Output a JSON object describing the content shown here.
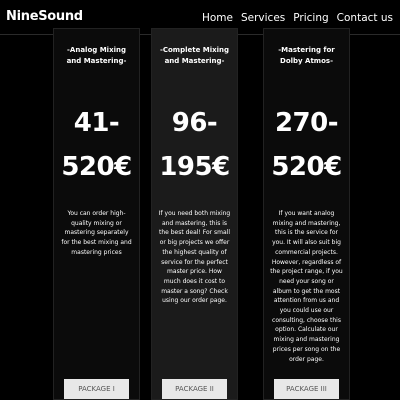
{
  "nav": {
    "brand": "NineSound",
    "links": [
      "Home",
      "Services",
      "Pricing",
      "Contact us"
    ]
  },
  "packages": [
    {
      "title": "-Analog Mixing and Mastering-",
      "price_line1": "41-",
      "price_line2": "520€",
      "description": "You can order high-quality mixing or mastering separately for the best mixing and mastering prices",
      "button": "PACKAGE I"
    },
    {
      "title": "-Complete Mixing and Mastering-",
      "price_line1": "96-",
      "price_line2": "195€",
      "description": "If you need both mixing and mastering, this is the best deal! For small or big projects we offer the highest quality of service for the perfect master price. How much does it cost to master a song? Check using our order page.",
      "button": "PACKAGE II"
    },
    {
      "title": "-Mastering for Dolby Atmos-",
      "price_line1": "270-",
      "price_line2": "520€",
      "description": "If you want analog mixing and mastering, this is the service for you. It will also suit big commercial projects. However, regardless of the project range, if you need your song or album to get the most attention from us and you could use our consulting, choose this option. Calculate our mixing and mastering prices per song on the order page.",
      "button": "PACKAGE III"
    }
  ]
}
